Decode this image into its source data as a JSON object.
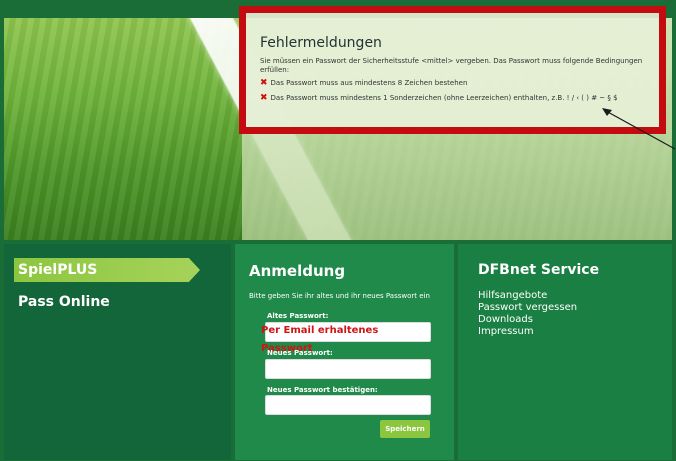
{
  "error": {
    "title": "Fehlermeldungen",
    "intro": "Sie müssen ein Passwort der Sicherheitsstufe <mittel> vergeben. Das Passwort muss folgende Bedingungen erfüllen:",
    "items": [
      "Das Passwort muss aus mindestens 8 Zeichen bestehen",
      "Das Passwort muss mindestens 1 Sonderzeichen (ohne Leerzeichen) enthalten, z.B. ! / ‹ ( ) # ~ § $"
    ]
  },
  "nav": {
    "spielplus": "SpielPLUS",
    "pass_online": "Pass Online"
  },
  "login": {
    "title": "Anmeldung",
    "description": "Bitte geben Sie ihr altes und ihr neues Passwort ein",
    "old_password_label": "Altes Passwort:",
    "old_password_value": "Per Email erhaltenes Passwort",
    "new_password_label": "Neues Passwort:",
    "confirm_password_label": "Neues Passwort bestätigen:",
    "save_label": "Speichern"
  },
  "service": {
    "title": "DFBnet Service",
    "links": [
      "Hilfsangebote",
      "Passwort vergessen",
      "Downloads",
      "Impressum"
    ]
  },
  "colors": {
    "error_border": "#c40c10",
    "accent_green": "#8cc63e",
    "panel_green": "#1f8a4a"
  }
}
